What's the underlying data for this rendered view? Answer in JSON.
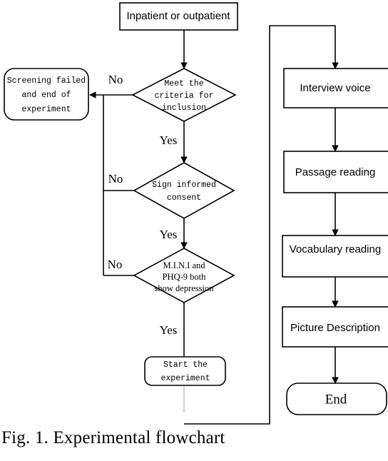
{
  "figure": {
    "caption": "Fig. 1. Experimental flowchart",
    "title": "Experimental flowchart"
  },
  "nodes": {
    "start": {
      "label": "Inpatient or outpatient",
      "shape": "rectangle"
    },
    "screening_failed": {
      "line1": "Screening failed",
      "line2": "and end of",
      "line3": "experiment",
      "shape": "rounded-rectangle"
    },
    "decision_inclusion": {
      "line1": "Meet the",
      "line2": "criteria for",
      "line3": "inclusion",
      "shape": "diamond"
    },
    "decision_consent": {
      "line1": "Sign informed",
      "line2": "consent",
      "shape": "diamond"
    },
    "decision_depression": {
      "line1": "M.I.N.I and",
      "line2": "PHQ-9 both",
      "line3": "show depression",
      "shape": "diamond"
    },
    "start_experiment": {
      "line1": "Start the",
      "line2": "experiment",
      "shape": "rounded-rectangle"
    },
    "interview_voice": {
      "label": "Interview voice",
      "shape": "rectangle"
    },
    "passage_reading": {
      "label": "Passage reading",
      "shape": "rectangle"
    },
    "vocabulary_reading": {
      "label": "Vocabulary reading",
      "shape": "rectangle"
    },
    "picture_description": {
      "label": "Picture Description",
      "shape": "rectangle"
    },
    "end": {
      "label": "End",
      "shape": "rounded-rectangle"
    }
  },
  "edge_labels": {
    "no_inclusion": "No",
    "yes_inclusion": "Yes",
    "no_consent": "No",
    "yes_consent": "Yes",
    "no_depression": "No",
    "yes_depression": "Yes"
  },
  "colors": {
    "stroke": "#000000",
    "fill": "#ffffff",
    "faint_connector": "#b5b5b5",
    "background": "#ffffff"
  }
}
